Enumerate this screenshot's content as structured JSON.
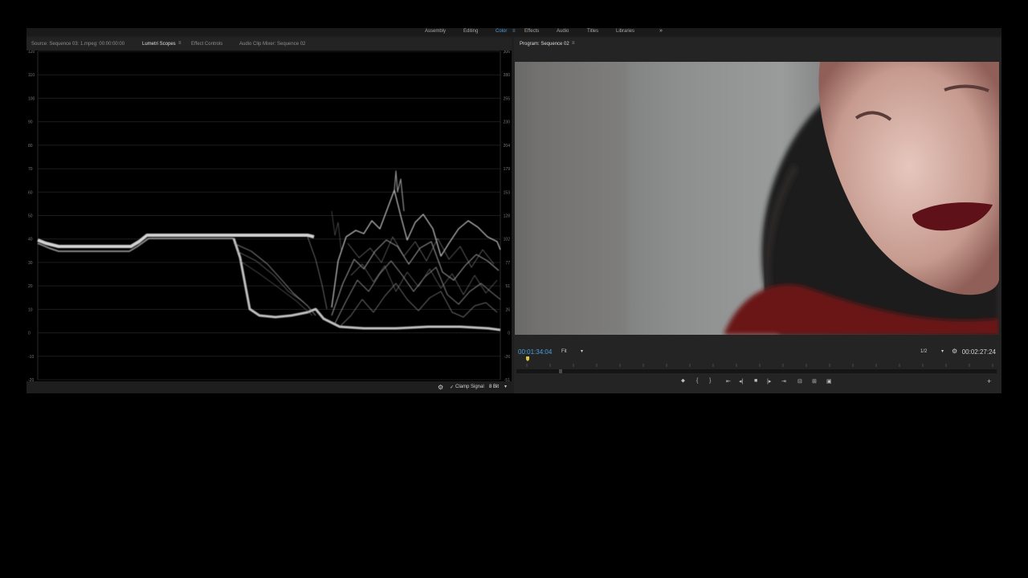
{
  "workspaces": {
    "items": [
      {
        "label": "Assembly"
      },
      {
        "label": "Editing"
      },
      {
        "label": "Color"
      },
      {
        "label": "Effects"
      },
      {
        "label": "Audio"
      },
      {
        "label": "Titles"
      },
      {
        "label": "Libraries"
      }
    ],
    "active": "Color",
    "overflow": "»"
  },
  "left_panel": {
    "tabs": [
      {
        "label": "Source: Sequence 03: 1.mpeg: 00:00:00:00"
      },
      {
        "label": "Lumetri Scopes"
      },
      {
        "label": "Effect Controls"
      },
      {
        "label": "Audio Clip Mixer: Sequence 02"
      }
    ],
    "active_tab": "Lumetri Scopes",
    "menu_icon": "≡",
    "scope": {
      "left_scale": [
        "120",
        "110",
        "100",
        "90",
        "80",
        "70",
        "60",
        "50",
        "40",
        "30",
        "20",
        "10",
        "0",
        "-10",
        "-20"
      ],
      "right_scale": [
        "306",
        "280",
        "255",
        "230",
        "204",
        "179",
        "153",
        "128",
        "102",
        "77",
        "51",
        "26",
        "0",
        "-26",
        "-51"
      ]
    },
    "bottom_bar": {
      "wrench_icon": "wrench-icon",
      "clamp_check": "✓",
      "clamp_label": "Clamp Signal",
      "bit_depth": "8 Bit",
      "dropdown": "▾"
    }
  },
  "right_panel": {
    "title": "Program: Sequence 02",
    "menu_icon": "≡",
    "current_timecode": "00:01:34:04",
    "zoom": "Fit",
    "zoom_arrow": "▾",
    "resolution": "1/2",
    "resolution_arrow": "▾",
    "duration_timecode": "00:02:27:24",
    "add_button": "+",
    "controls": {
      "marker": "⬥",
      "mark_in": "{",
      "mark_out": "}",
      "go_to_in": "⇤",
      "step_back": "◂|",
      "stop": "■",
      "step_forward": "|▸",
      "go_to_out": "⇥",
      "lift": "⊟",
      "extract": "⊞",
      "export_frame": "▣"
    }
  },
  "colors": {
    "accent": "#4b9fe0",
    "panel": "#212121",
    "background": "#000000"
  }
}
